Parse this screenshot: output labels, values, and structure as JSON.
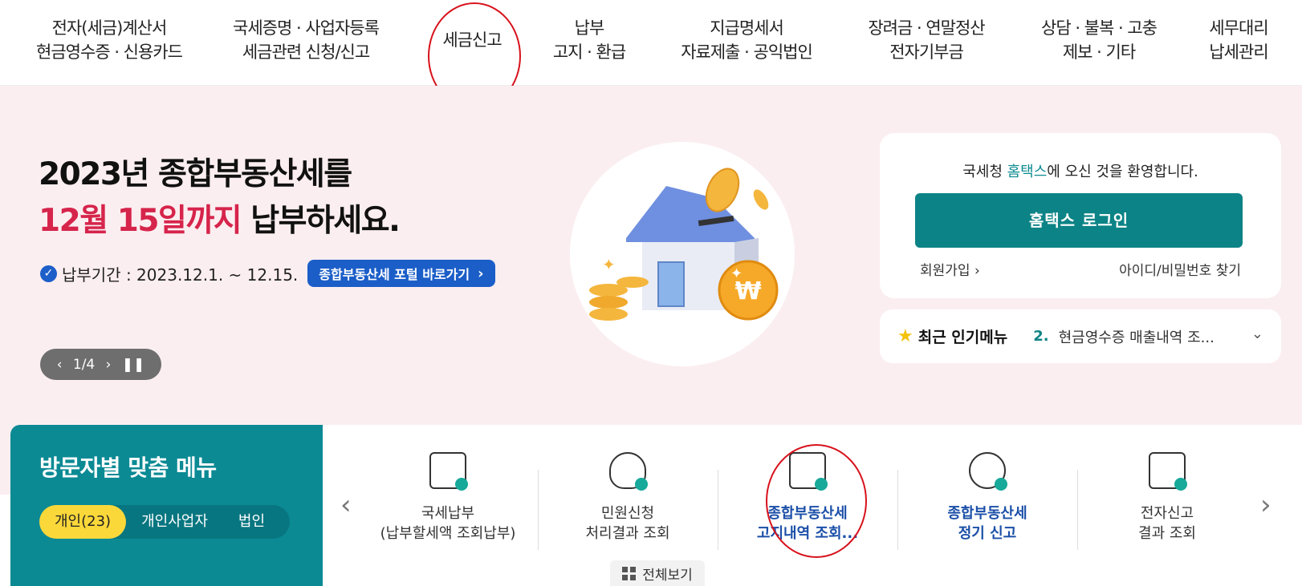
{
  "nav": [
    {
      "line1": "전자(세금)계산서",
      "line2": "현금영수증 · 신용카드"
    },
    {
      "line1": "국세증명 · 사업자등록",
      "line2": "세금관련 신청/신고"
    },
    {
      "line1": "세금신고",
      "line2": ""
    },
    {
      "line1": "납부",
      "line2": "고지 · 환급"
    },
    {
      "line1": "지급명세서",
      "line2": "자료제출 · 공익법인"
    },
    {
      "line1": "장려금 · 연말정산",
      "line2": "전자기부금"
    },
    {
      "line1": "상담 · 불복 · 고충",
      "line2": "제보 · 기타"
    },
    {
      "line1": "세무대리",
      "line2": "납세관리"
    }
  ],
  "hero": {
    "title_line1": "2023년 종합부동산세를",
    "title_accent": "12월 15일까지",
    "title_rest": " 납부하세요.",
    "period": "납부기간 : 2023.12.1. ~ 12.15.",
    "portal_button": "종합부동산세 포털 바로가기",
    "slide_counter": "1/4"
  },
  "login": {
    "welcome_prefix": "국세청 ",
    "welcome_brand": "홈택스",
    "welcome_suffix": "에 오신 것을 환영합니다.",
    "login_button": "홈택스 로그인",
    "join": "회원가입",
    "find": "아이디/비밀번호 찾기"
  },
  "popular": {
    "title": "최근 인기메뉴",
    "rank": "2.",
    "text": "현금영수증 매출내역 조..."
  },
  "visitor": {
    "title": "방문자별 맞춤 메뉴",
    "tabs": [
      "개인(23)",
      "개인사업자",
      "법인"
    ]
  },
  "menu": [
    {
      "line1": "국세납부",
      "line2": "(납부할세액 조회납부)",
      "highlight": false
    },
    {
      "line1": "민원신청",
      "line2": "처리결과 조회",
      "highlight": false
    },
    {
      "line1": "종합부동산세",
      "line2": "고지내역 조회...",
      "highlight": true
    },
    {
      "line1": "종합부동산세",
      "line2": "정기 신고",
      "highlight": true
    },
    {
      "line1": "전자신고",
      "line2": "결과 조회",
      "highlight": false
    }
  ],
  "all_view": "전체보기",
  "colors": {
    "teal": "#0c8386",
    "accent_red": "#d6244b",
    "annotation_red": "#d8121c"
  }
}
